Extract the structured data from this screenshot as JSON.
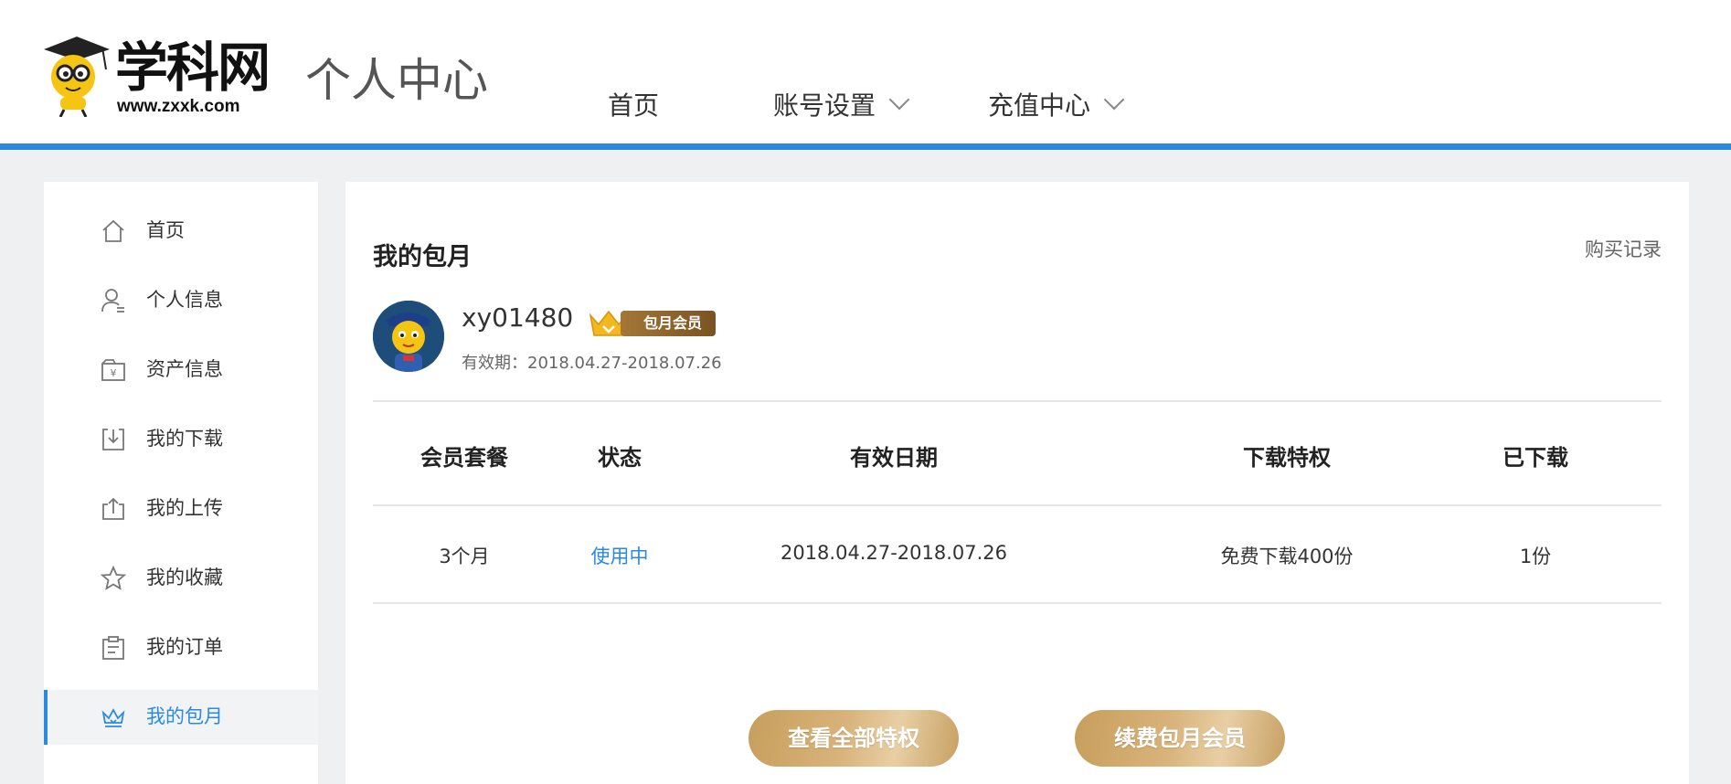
{
  "header": {
    "logo_text": "学科网",
    "logo_url": "www.zxxk.com",
    "page_title": "个人中心",
    "nav": [
      {
        "label": "首页"
      },
      {
        "label": "账号设置"
      },
      {
        "label": "充值中心"
      }
    ],
    "accent_color": "#2a8ae0"
  },
  "sidebar": {
    "items": [
      {
        "label": "首页",
        "icon": "home-icon"
      },
      {
        "label": "个人信息",
        "icon": "user-icon"
      },
      {
        "label": "资产信息",
        "icon": "wallet-icon"
      },
      {
        "label": "我的下载",
        "icon": "download-icon"
      },
      {
        "label": "我的上传",
        "icon": "upload-icon"
      },
      {
        "label": "我的收藏",
        "icon": "star-icon"
      },
      {
        "label": "我的订单",
        "icon": "order-icon"
      },
      {
        "label": "我的包月",
        "icon": "crown-icon",
        "active": true
      }
    ]
  },
  "main": {
    "section_title": "我的包月",
    "purchase_record_label": "购买记录",
    "user": {
      "name": "xy01480",
      "badge": "包月会员",
      "validity": "有效期：2018.04.27-2018.07.26"
    },
    "table": {
      "headers": [
        "会员套餐",
        "状态",
        "有效日期",
        "下载特权",
        "已下载"
      ],
      "rows": [
        [
          "3个月",
          "使用中",
          "2018.04.27-2018.07.26",
          "免费下载400份",
          "1份"
        ]
      ]
    },
    "buttons": {
      "view_privileges": "查看全部特权",
      "renew": "续费包月会员"
    }
  }
}
